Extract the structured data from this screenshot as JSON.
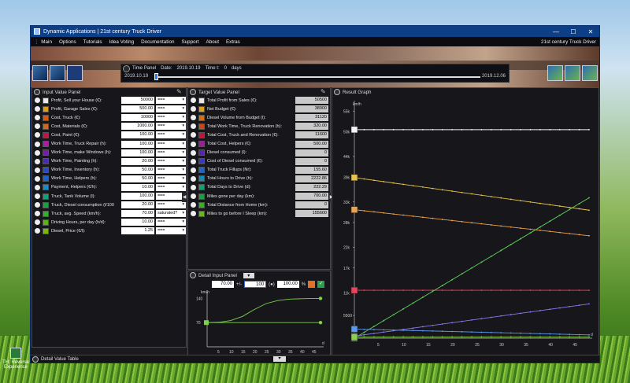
{
  "window": {
    "title": "Dynamic Applications | 21st century Truck Driver",
    "minimize": "—",
    "maximize": "☐",
    "close": "✕"
  },
  "menu": {
    "items": [
      "Main",
      "Options",
      "Tutorials",
      "Idea Voting",
      "Documentation",
      "Support",
      "About",
      "Extras"
    ],
    "right": "21st century Truck Driver"
  },
  "time_panel": {
    "title": "Time Panel",
    "date_label": "Date:",
    "date": "2019.10.19",
    "time_label": "Time t:",
    "time": "0",
    "time_unit": "days",
    "start": "2019.10.19",
    "end": "2019.12.06",
    "progress": 0
  },
  "input_panel": {
    "title": "Input Value Panel",
    "rows": [
      {
        "label": "Profit, Sell your House (€):",
        "value": "50000",
        "select": "===",
        "color": "#e8e8e8"
      },
      {
        "label": "Profit, Garage Sales (€):",
        "value": "500.00",
        "select": "===",
        "color": "#e09a1c"
      },
      {
        "label": "Cost, Truck (€):",
        "value": "10000",
        "select": "===",
        "color": "#d05a12"
      },
      {
        "label": "Cost, Materials (€):",
        "value": "1000.00",
        "select": "===",
        "color": "#d0681a"
      },
      {
        "label": "Cost, Paint (€):",
        "value": "100.00",
        "select": "===",
        "color": "#c0144a"
      },
      {
        "label": "Work Time, Truck Repair (h):",
        "value": "100.00",
        "select": "===",
        "color": "#b01aa8"
      },
      {
        "label": "Work Time, make Windows (h):",
        "value": "100.00",
        "select": "===",
        "color": "#7a1ab4"
      },
      {
        "label": "Work Time, Painting (h):",
        "value": "20.00",
        "select": "===",
        "color": "#4a2ab8"
      },
      {
        "label": "Work Time, Inventory (h):",
        "value": "50.00",
        "select": "===",
        "color": "#2a4ac8"
      },
      {
        "label": "Work Time, Helpers (h):",
        "value": "50.00",
        "select": "===",
        "color": "#1a62d0"
      },
      {
        "label": "Payment, Helpers (€/h):",
        "value": "10.00",
        "select": "===",
        "color": "#1a8acc"
      },
      {
        "label": "Truck, Tank Volume (l):",
        "value": "100.00",
        "select": "===",
        "color": "#14a070"
      },
      {
        "label": "Truck, Diesel consumption (l/100 km):",
        "value": "20.00",
        "select": "===",
        "color": "#1aa040"
      },
      {
        "label": "Truck, avg. Speed (km/h):",
        "value": "70.00",
        "select": "saturated?",
        "color": "#32b02a"
      },
      {
        "label": "Driving Hours, per day (h/d):",
        "value": "10.00",
        "select": "===",
        "color": "#58b41a"
      },
      {
        "label": "Diesel, Price (€/l):",
        "value": "1.25",
        "select": "===",
        "color": "#7ab80e"
      }
    ]
  },
  "target_panel": {
    "title": "Target Value Panel",
    "rows": [
      {
        "label": "Total Profit from Sales (€):",
        "value": "50500",
        "color": "#e8e8e8"
      },
      {
        "label": "Net Budget (€):",
        "value": "38900",
        "color": "#e0a01c"
      },
      {
        "label": "Diesel Volume from Budget (l):",
        "value": "31120",
        "color": "#d27018"
      },
      {
        "label": "Total Work Time, Truck Renovation (h):",
        "value": "320.00",
        "color": "#c84818"
      },
      {
        "label": "Total Cost, Truck and Renovation (€):",
        "value": "11600",
        "color": "#c0143c"
      },
      {
        "label": "Total Cost, Helpers (€):",
        "value": "500.00",
        "color": "#a01aa0"
      },
      {
        "label": "Diesel consumed (l):",
        "value": "0",
        "color": "#5a24b0"
      },
      {
        "label": "Cost of Diesel consumed (€):",
        "value": "0",
        "color": "#3a3ac0"
      },
      {
        "label": "Total Truck Fillups (Nr):",
        "value": "155.60",
        "color": "#1a66cc"
      },
      {
        "label": "Total Hours to Drive (h):",
        "value": "2222.86",
        "color": "#148ab4"
      },
      {
        "label": "Total Days to Drive (d):",
        "value": "222.29",
        "color": "#14a070"
      },
      {
        "label": "Miles gone per day (km):",
        "value": "700.00",
        "color": "#1aa040"
      },
      {
        "label": "Total Distance from Home (km):",
        "value": "0",
        "color": "#3aae26"
      },
      {
        "label": "Miles to go before I Sleep (km):",
        "value": "155600",
        "color": "#6ab818"
      }
    ]
  },
  "detail_panel": {
    "title": "Detail Input Panel",
    "value": "70.00",
    "op": "+/-",
    "delta": "100",
    "unit": "(●)",
    "percent": "100.00",
    "percent_unit": "%",
    "ylabel": "km/h",
    "xlabel": "d"
  },
  "result_panel": {
    "title": "Result Graph",
    "ylabel": "km/h",
    "xlabel": "d"
  },
  "bottom": {
    "title": "Detail Value Table"
  },
  "desktop": {
    "icon_label": "TH: Reverse Experience"
  },
  "chart_data": [
    {
      "type": "line",
      "title": "Detail Input Panel",
      "xlabel": "d",
      "ylabel": "km/h",
      "xlim": [
        0,
        48
      ],
      "ylim": [
        0,
        150
      ],
      "x_ticks": [
        "5",
        "10",
        "15",
        "20",
        "25",
        "30",
        "35",
        "40",
        "45"
      ],
      "y_ticks": [
        "140",
        "70"
      ],
      "series": [
        {
          "name": "",
          "values_x": [
            0,
            5,
            10,
            15,
            20,
            25,
            30,
            35,
            40,
            45,
            48
          ],
          "values_y": [
            70,
            71,
            76,
            88,
            108,
            125,
            134,
            138,
            139,
            140,
            140
          ],
          "color": "#7fd34a"
        },
        {
          "name": "",
          "values_x": [
            0,
            48
          ],
          "values_y": [
            70,
            70
          ],
          "color": "#7fd34a"
        }
      ]
    },
    {
      "type": "line",
      "title": "Result Graph",
      "xlabel": "d",
      "ylabel": "km/h",
      "xlim": [
        0,
        48
      ],
      "ylim": [
        0,
        56000
      ],
      "x_ticks": [
        "5",
        "10",
        "15",
        "20",
        "25",
        "30",
        "35",
        "40",
        "45"
      ],
      "y_ticks": [
        "55k",
        "50k",
        "44k",
        "39k",
        "33k",
        "28k",
        "22k",
        "17k",
        "11k",
        "5500"
      ],
      "series": [
        {
          "name": "",
          "x": [
            0,
            48
          ],
          "y": [
            50500,
            50500
          ],
          "color": "#f4f4f4"
        },
        {
          "name": "",
          "x": [
            0,
            48
          ],
          "y": [
            38900,
            31000
          ],
          "color": "#e8c24a"
        },
        {
          "name": "",
          "x": [
            0,
            48
          ],
          "y": [
            31120,
            24800
          ],
          "color": "#f0a24a"
        },
        {
          "name": "",
          "x": [
            0,
            48
          ],
          "y": [
            11600,
            11600
          ],
          "color": "#e8445a"
        },
        {
          "name": "",
          "x": [
            0,
            48
          ],
          "y": [
            0,
            34000
          ],
          "color": "#5fd45a"
        },
        {
          "name": "",
          "x": [
            0,
            48
          ],
          "y": [
            500,
            8300
          ],
          "color": "#8a7af0"
        },
        {
          "name": "",
          "x": [
            0,
            48
          ],
          "y": [
            2200,
            800
          ],
          "color": "#5a9af0"
        },
        {
          "name": "",
          "x": [
            0,
            48
          ],
          "y": [
            300,
            300
          ],
          "color": "#8ad24a"
        }
      ]
    }
  ]
}
